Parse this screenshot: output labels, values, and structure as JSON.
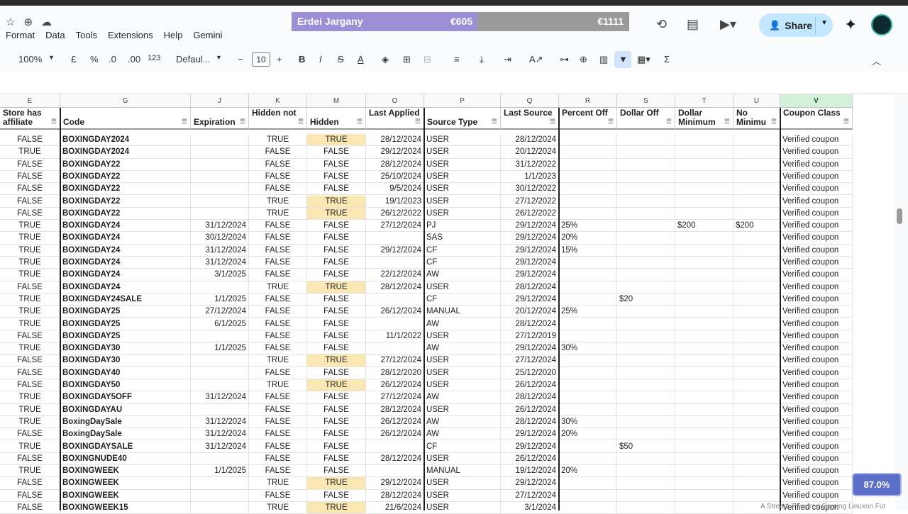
{
  "menu": [
    "Format",
    "Data",
    "Tools",
    "Extensions",
    "Help",
    "Gemini"
  ],
  "banner": {
    "name": "Erdei Jargany",
    "amount_a": "€605",
    "amount_b": "€1111"
  },
  "share_label": "Share",
  "toolbar": {
    "zoom": "100%",
    "currency": "£",
    "percent": "%",
    "dec_less": ".0",
    "dec_more": ".00",
    "number_format": "123",
    "font": "Defaul...",
    "font_size": "10",
    "bold": "B",
    "italic": "I",
    "strike": "S",
    "text_color": "A",
    "sum": "Σ",
    "minus": "−",
    "plus": "+"
  },
  "columns": [
    {
      "letter": "E",
      "header": "Store has affiliate"
    },
    {
      "letter": "G",
      "header": "Code"
    },
    {
      "letter": "J",
      "header": "Expiration"
    },
    {
      "letter": "K",
      "header": "Hidden not"
    },
    {
      "letter": "M",
      "header": "Hidden"
    },
    {
      "letter": "O",
      "header": "Last Applied"
    },
    {
      "letter": "P",
      "header": "Source Type"
    },
    {
      "letter": "Q",
      "header": "Last Source"
    },
    {
      "letter": "R",
      "header": "Percent Off"
    },
    {
      "letter": "S",
      "header": "Dollar Off"
    },
    {
      "letter": "T",
      "header": "Dollar Minimum"
    },
    {
      "letter": "U",
      "header": "No Minimu"
    },
    {
      "letter": "V",
      "header": "Coupon Class"
    }
  ],
  "rows": [
    [
      "FALSE",
      "BOXINGDAY2024",
      "",
      "TRUE",
      "TRUE",
      "28/12/2024",
      "USER",
      "28/12/2024",
      "",
      "",
      "",
      "",
      "Verified coupon"
    ],
    [
      "TRUE",
      "BOXINGDAY2024",
      "",
      "FALSE",
      "FALSE",
      "29/12/2024",
      "USER",
      "20/12/2024",
      "",
      "",
      "",
      "",
      "Verified coupon"
    ],
    [
      "FALSE",
      "BOXINGDAY22",
      "",
      "FALSE",
      "FALSE",
      "28/12/2024",
      "USER",
      "31/12/2022",
      "",
      "",
      "",
      "",
      "Verified coupon"
    ],
    [
      "FALSE",
      "BOXINGDAY22",
      "",
      "FALSE",
      "FALSE",
      "25/10/2024",
      "USER",
      "1/1/2023",
      "",
      "",
      "",
      "",
      "Verified coupon"
    ],
    [
      "FALSE",
      "BOXINGDAY22",
      "",
      "FALSE",
      "FALSE",
      "9/5/2024",
      "USER",
      "30/12/2022",
      "",
      "",
      "",
      "",
      "Verified coupon"
    ],
    [
      "FALSE",
      "BOXINGDAY22",
      "",
      "TRUE",
      "TRUE",
      "19/1/2023",
      "USER",
      "27/12/2022",
      "",
      "",
      "",
      "",
      "Verified coupon"
    ],
    [
      "FALSE",
      "BOXINGDAY22",
      "",
      "TRUE",
      "TRUE",
      "26/12/2022",
      "USER",
      "26/12/2022",
      "",
      "",
      "",
      "",
      "Verified coupon"
    ],
    [
      "TRUE",
      "BOXINGDAY24",
      "31/12/2024",
      "FALSE",
      "FALSE",
      "27/12/2024",
      "PJ",
      "29/12/2024",
      "25%",
      "",
      "$200",
      "$200",
      "Verified coupon"
    ],
    [
      "TRUE",
      "BOXINGDAY24",
      "30/12/2024",
      "FALSE",
      "FALSE",
      "",
      "SAS",
      "29/12/2024",
      "20%",
      "",
      "",
      "",
      "Verified coupon"
    ],
    [
      "TRUE",
      "BOXINGDAY24",
      "31/12/2024",
      "FALSE",
      "FALSE",
      "29/12/2024",
      "CF",
      "29/12/2024",
      "15%",
      "",
      "",
      "",
      "Verified coupon"
    ],
    [
      "TRUE",
      "BOXINGDAY24",
      "31/12/2024",
      "FALSE",
      "FALSE",
      "",
      "CF",
      "29/12/2024",
      "",
      "",
      "",
      "",
      "Verified coupon"
    ],
    [
      "TRUE",
      "BOXINGDAY24",
      "3/1/2025",
      "FALSE",
      "FALSE",
      "22/12/2024",
      "AW",
      "29/12/2024",
      "",
      "",
      "",
      "",
      "Verified coupon"
    ],
    [
      "FALSE",
      "BOXINGDAY24",
      "",
      "TRUE",
      "TRUE",
      "28/12/2024",
      "USER",
      "28/12/2024",
      "",
      "",
      "",
      "",
      "Verified coupon"
    ],
    [
      "TRUE",
      "BOXINGDAY24SALE",
      "1/1/2025",
      "FALSE",
      "FALSE",
      "",
      "CF",
      "29/12/2024",
      "",
      "$20",
      "",
      "",
      "Verified coupon"
    ],
    [
      "TRUE",
      "BOXINGDAY25",
      "27/12/2024",
      "FALSE",
      "FALSE",
      "26/12/2024",
      "MANUAL",
      "20/12/2024",
      "25%",
      "",
      "",
      "",
      "Verified coupon"
    ],
    [
      "TRUE",
      "BOXINGDAY25",
      "6/1/2025",
      "FALSE",
      "FALSE",
      "",
      "AW",
      "28/12/2024",
      "",
      "",
      "",
      "",
      "Verified coupon"
    ],
    [
      "FALSE",
      "BOXINGDAY25",
      "",
      "FALSE",
      "FALSE",
      "11/1/2022",
      "USER",
      "27/12/2019",
      "",
      "",
      "",
      "",
      "Verified coupon"
    ],
    [
      "TRUE",
      "BOXINGDAY30",
      "1/1/2025",
      "FALSE",
      "FALSE",
      "",
      "AW",
      "29/12/2024",
      "30%",
      "",
      "",
      "",
      "Verified coupon"
    ],
    [
      "FALSE",
      "BOXINGDAY30",
      "",
      "TRUE",
      "TRUE",
      "27/12/2024",
      "USER",
      "27/12/2024",
      "",
      "",
      "",
      "",
      "Verified coupon"
    ],
    [
      "FALSE",
      "BOXINGDAY40",
      "",
      "FALSE",
      "FALSE",
      "28/12/2020",
      "USER",
      "25/12/2020",
      "",
      "",
      "",
      "",
      "Verified coupon"
    ],
    [
      "FALSE",
      "BOXINGDAY50",
      "",
      "TRUE",
      "TRUE",
      "26/12/2024",
      "USER",
      "26/12/2024",
      "",
      "",
      "",
      "",
      "Verified coupon"
    ],
    [
      "TRUE",
      "BOXINGDAY5OFF",
      "31/12/2024",
      "FALSE",
      "FALSE",
      "27/12/2024",
      "AW",
      "28/12/2024",
      "",
      "",
      "",
      "",
      "Verified coupon"
    ],
    [
      "TRUE",
      "BOXINGDAYAU",
      "",
      "FALSE",
      "FALSE",
      "28/12/2024",
      "USER",
      "26/12/2024",
      "",
      "",
      "",
      "",
      "Verified coupon"
    ],
    [
      "TRUE",
      "BoxingDaySale",
      "31/12/2024",
      "FALSE",
      "FALSE",
      "26/12/2024",
      "AW",
      "28/12/2024",
      "30%",
      "",
      "",
      "",
      "Verified coupon"
    ],
    [
      "FALSE",
      "BoxingDaySale",
      "31/12/2024",
      "FALSE",
      "FALSE",
      "26/12/2024",
      "AW",
      "29/12/2024",
      "20%",
      "",
      "",
      "",
      "Verified coupon"
    ],
    [
      "TRUE",
      "BOXINGDAYSALE",
      "31/12/2024",
      "FALSE",
      "FALSE",
      "",
      "CF",
      "29/12/2024",
      "",
      "$50",
      "",
      "",
      "Verified coupon"
    ],
    [
      "FALSE",
      "BOXINGNUDE40",
      "",
      "FALSE",
      "FALSE",
      "28/12/2024",
      "USER",
      "26/12/2024",
      "",
      "",
      "",
      "",
      "Verified coupon"
    ],
    [
      "TRUE",
      "BOXINGWEEK",
      "1/1/2025",
      "FALSE",
      "FALSE",
      "",
      "MANUAL",
      "19/12/2024",
      "20%",
      "",
      "",
      "",
      "Verified coupon"
    ],
    [
      "FALSE",
      "BOXINGWEEK",
      "",
      "TRUE",
      "TRUE",
      "29/12/2024",
      "USER",
      "29/12/2024",
      "",
      "",
      "",
      "",
      "Verified coupon"
    ],
    [
      "FALSE",
      "BOXINGWEEK",
      "",
      "FALSE",
      "FALSE",
      "28/12/2024",
      "USER",
      "27/12/2024",
      "",
      "",
      "",
      "",
      "Verified coupon"
    ],
    [
      "FALSE",
      "BOXINGWEEK15",
      "",
      "TRUE",
      "TRUE",
      "21/6/2024",
      "USER",
      "3/1/2024",
      "",
      "",
      "",
      "",
      "Verified coupon"
    ]
  ],
  "zoom_badge": "87.0%",
  "watermark": "A Stream Powered Gaming Linuxon Fut"
}
